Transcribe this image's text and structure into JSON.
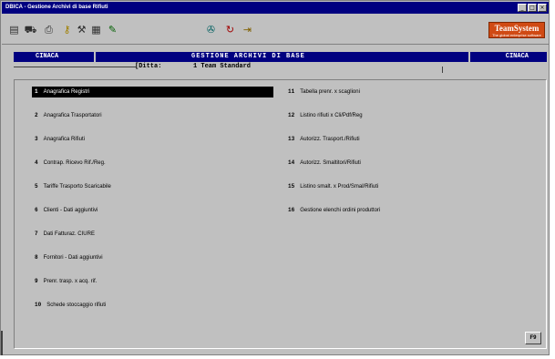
{
  "window": {
    "title": "DBICA - Gestione Archivi di base Rifiuti",
    "controls": [
      "_",
      "□",
      "×"
    ]
  },
  "toolbar": {
    "icons": [
      "notes-icon",
      "car-icon",
      "printer-icon",
      "key-icon",
      "tools-icon",
      "calculator-icon",
      "pen-icon",
      "diskette-icon",
      "refresh-icon",
      "exit-icon"
    ],
    "logo_main": "TeamSystem",
    "logo_sub": "The global enterprise software"
  },
  "header": {
    "left": "CINACA",
    "title": "GESTIONE ARCHIVI DI BASE",
    "right": "CINACA"
  },
  "ditta": {
    "label": "[Ditta:",
    "value": "1 Team Standard"
  },
  "menu": {
    "left": [
      {
        "num": "1",
        "label": "Anagrafica Registri",
        "selected": true
      },
      {
        "num": "2",
        "label": "Anagrafica Trasportatori"
      },
      {
        "num": "3",
        "label": "Anagrafica Rifiuti"
      },
      {
        "num": "4",
        "label": "Contrap. Ricevo Rif./Reg."
      },
      {
        "num": "5",
        "label": "Tariffe Trasporto Scaricabile"
      },
      {
        "num": "6",
        "label": "Clienti - Dati aggiuntivi"
      },
      {
        "num": "7",
        "label": "Dati Fatturaz. CIURE"
      },
      {
        "num": "8",
        "label": "Fornitori - Dati aggiuntivi"
      },
      {
        "num": "9",
        "label": "Prenr. trasp. x acq. rif."
      },
      {
        "num": "10",
        "label": "Schede stoccaggio rifiuti"
      }
    ],
    "right": [
      {
        "num": "11",
        "label": "Tabella prenr. x scaglioni"
      },
      {
        "num": "12",
        "label": "Listino rifiuti x Cli/Pdf/Reg"
      },
      {
        "num": "13",
        "label": "Autorizz. Trasport./Rifiuti"
      },
      {
        "num": "14",
        "label": "Autorizz. Smaltitori/Rifiuti"
      },
      {
        "num": "15",
        "label": "Listino smalt. x Prod/Smal/Rifiuti"
      },
      {
        "num": "16",
        "label": "Gestione elenchi ordini produttori"
      }
    ]
  },
  "f9_label": "F9"
}
